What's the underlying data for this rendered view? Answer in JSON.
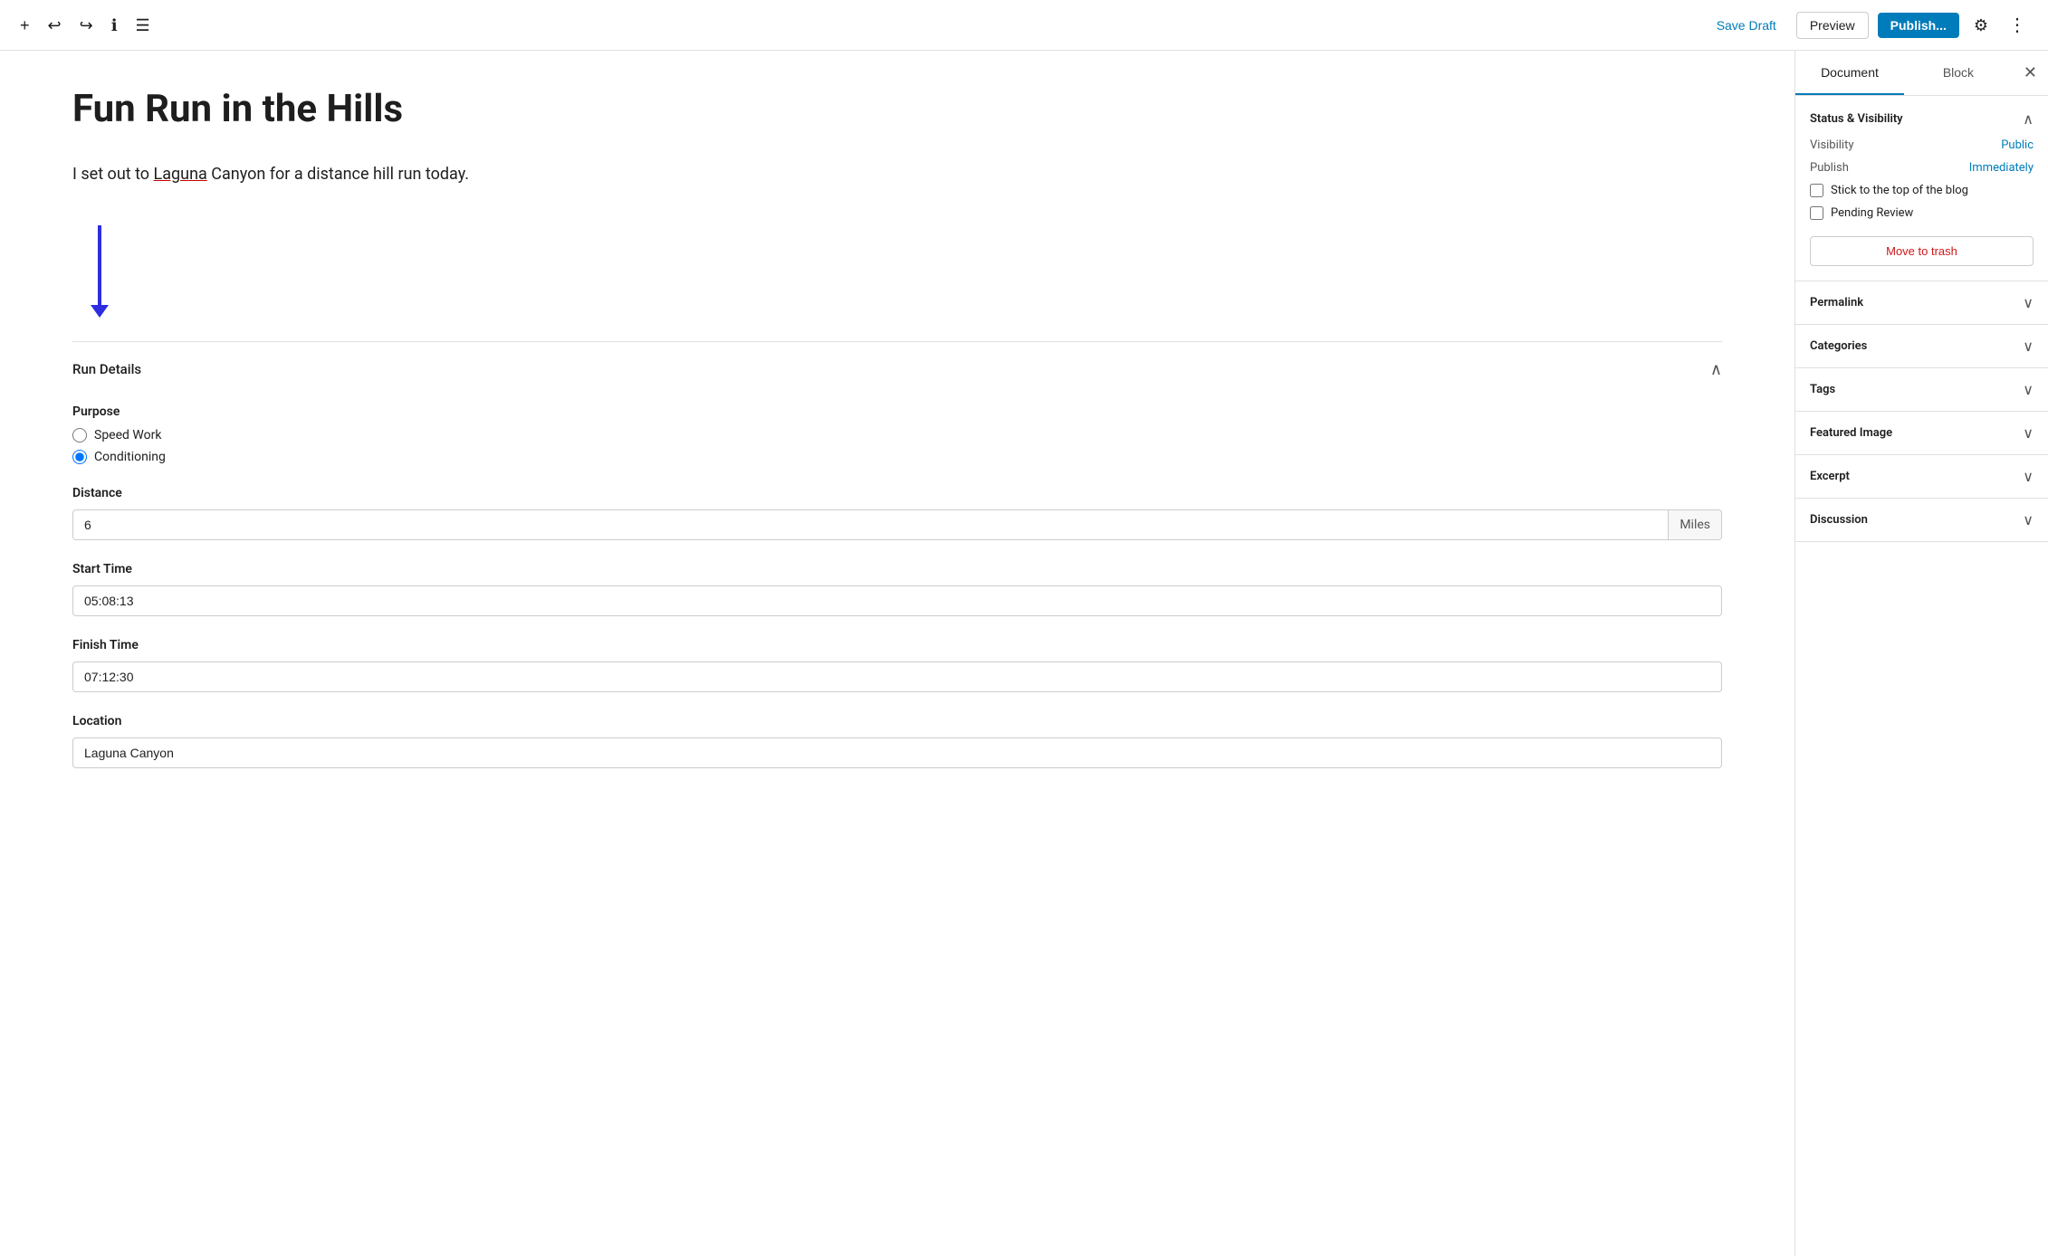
{
  "toolbar": {
    "save_draft": "Save Draft",
    "preview": "Preview",
    "publish": "Publish...",
    "icons": {
      "add": "+",
      "undo": "↩",
      "redo": "↪",
      "info": "ℹ",
      "list": "☰",
      "gear": "⚙",
      "more": "⋮"
    }
  },
  "editor": {
    "title": "Fun Run in the Hills",
    "content_before": "I set out to ",
    "content_link": "Laguna",
    "content_after": " Canyon for a distance hill run today."
  },
  "run_details": {
    "section_title": "Run Details",
    "purpose_label": "Purpose",
    "purpose_options": [
      {
        "label": "Speed Work",
        "value": "speed_work",
        "checked": false
      },
      {
        "label": "Conditioning",
        "value": "conditioning",
        "checked": true
      }
    ],
    "distance_label": "Distance",
    "distance_value": "6",
    "distance_unit": "Miles",
    "start_time_label": "Start Time",
    "start_time_value": "05:08:13",
    "finish_time_label": "Finish Time",
    "finish_time_value": "07:12:30",
    "location_label": "Location",
    "location_value": "Laguna Canyon"
  },
  "sidebar": {
    "tab_document": "Document",
    "tab_block": "Block",
    "status_visibility": {
      "title": "Status & Visibility",
      "visibility_label": "Visibility",
      "visibility_value": "Public",
      "publish_label": "Publish",
      "publish_value": "Immediately",
      "stick_label": "Stick to the top of the blog",
      "pending_label": "Pending Review",
      "move_to_trash": "Move to trash"
    },
    "permalink": {
      "title": "Permalink"
    },
    "categories": {
      "title": "Categories"
    },
    "tags": {
      "title": "Tags"
    },
    "featured_image": {
      "title": "Featured Image"
    },
    "excerpt": {
      "title": "Excerpt"
    },
    "discussion": {
      "title": "Discussion"
    }
  }
}
